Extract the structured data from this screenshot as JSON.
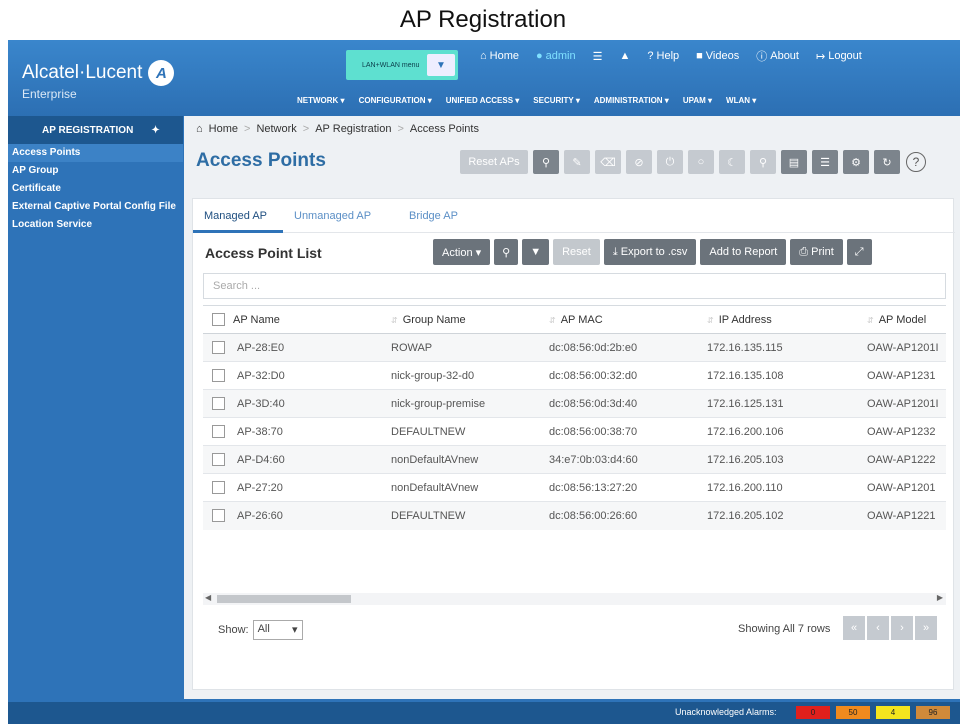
{
  "caption": "AP Registration",
  "header": {
    "brand": "Alcatel·Lucent",
    "brand_sub": "Enterprise",
    "menu_select": "LAN+WLAN menu",
    "links": {
      "home": "Home",
      "admin": "admin",
      "help": "Help",
      "videos": "Videos",
      "about": "About",
      "logout": "Logout"
    },
    "nav": [
      "NETWORK ▾",
      "CONFIGURATION ▾",
      "UNIFIED ACCESS ▾",
      "SECURITY ▾",
      "ADMINISTRATION ▾",
      "UPAM ▾",
      "WLAN ▾"
    ]
  },
  "sidebar": {
    "title": "AP REGISTRATION",
    "items": [
      "Access Points",
      "AP Group",
      "Certificate",
      "External Captive Portal Config File",
      "Location Service"
    ]
  },
  "breadcrumb": [
    "Home",
    "Network",
    "AP Registration",
    "Access Points"
  ],
  "page": {
    "title": "Access Points",
    "reset_aps": "Reset APs"
  },
  "tabs": [
    "Managed AP",
    "Unmanaged AP",
    "Bridge AP"
  ],
  "list": {
    "title": "Access Point List",
    "action": "Action ▾",
    "reset": "Reset",
    "export": "Export to .csv",
    "add_report": "Add to Report",
    "print": "Print",
    "search_placeholder": "Search ..."
  },
  "table": {
    "columns": [
      "AP Name",
      "Group Name",
      "AP MAC",
      "IP Address",
      "AP Model"
    ],
    "rows": [
      [
        "AP-28:E0",
        "ROWAP",
        "dc:08:56:0d:2b:e0",
        "172.16.135.115",
        "OAW-AP1201I"
      ],
      [
        "AP-32:D0",
        "nick-group-32-d0",
        "dc:08:56:00:32:d0",
        "172.16.135.108",
        "OAW-AP1231"
      ],
      [
        "AP-3D:40",
        "nick-group-premise",
        "dc:08:56:0d:3d:40",
        "172.16.125.131",
        "OAW-AP1201I"
      ],
      [
        "AP-38:70",
        "DEFAULTNEW",
        "dc:08:56:00:38:70",
        "172.16.200.106",
        "OAW-AP1232"
      ],
      [
        "AP-D4:60",
        "nonDefaultAVnew",
        "34:e7:0b:03:d4:60",
        "172.16.205.103",
        "OAW-AP1222"
      ],
      [
        "AP-27:20",
        "nonDefaultAVnew",
        "dc:08:56:13:27:20",
        "172.16.200.110",
        "OAW-AP1201"
      ],
      [
        "AP-26:60",
        "DEFAULTNEW",
        "dc:08:56:00:26:60",
        "172.16.205.102",
        "OAW-AP1221"
      ]
    ]
  },
  "pagination": {
    "show_label": "Show:",
    "show_value": "All",
    "summary": "Showing All 7 rows"
  },
  "footer": {
    "label": "Unacknowledged Alarms:",
    "alarms": [
      {
        "value": "0",
        "color": "#e0201c"
      },
      {
        "value": "50",
        "color": "#f08a1e"
      },
      {
        "value": "4",
        "color": "#f4e41e"
      },
      {
        "value": "96",
        "color": "#d08a3a"
      }
    ]
  },
  "colors": {
    "brand_blue": "#2e73b8",
    "dark_blue": "#1d578f",
    "menu_teal": "#5ee0d0"
  }
}
